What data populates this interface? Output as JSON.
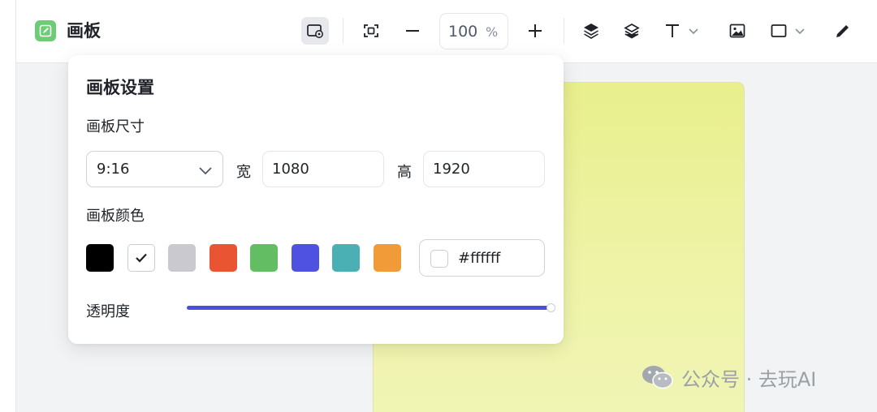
{
  "app": {
    "title": "画板",
    "logo_icon": "edit-board-icon",
    "logo_color": "#6ecb76"
  },
  "toolbar": {
    "items": [
      {
        "name": "board-settings-button",
        "icon": "board-settings-icon",
        "active": true
      },
      {
        "name": "fit-screen-button",
        "icon": "fit-screen-icon"
      },
      {
        "name": "zoom-out-button",
        "icon": "minus-icon"
      },
      {
        "name": "zoom-in-button",
        "icon": "plus-icon"
      },
      {
        "name": "layer-up-button",
        "icon": "layer-up-icon"
      },
      {
        "name": "layer-down-button",
        "icon": "layers-icon"
      },
      {
        "name": "text-tool-button",
        "icon": "text-icon",
        "has_dropdown": true
      },
      {
        "name": "image-tool-button",
        "icon": "image-icon"
      },
      {
        "name": "shape-tool-button",
        "icon": "rectangle-icon",
        "has_dropdown": true
      },
      {
        "name": "pen-tool-button",
        "icon": "pen-icon"
      }
    ],
    "zoom": {
      "value": "100",
      "unit": "%"
    }
  },
  "panel": {
    "title": "画板设置",
    "size": {
      "label": "画板尺寸",
      "ratio_value": "9:16",
      "width_label": "宽",
      "width_value": "1080",
      "height_label": "高",
      "height_value": "1920"
    },
    "color": {
      "label": "画板颜色",
      "swatches": [
        {
          "name": "black",
          "hex": "#000000",
          "selected": false
        },
        {
          "name": "white",
          "hex": "#ffffff",
          "selected": true
        },
        {
          "name": "gray",
          "hex": "#c9c9cf",
          "selected": false
        },
        {
          "name": "red",
          "hex": "#e95432",
          "selected": false
        },
        {
          "name": "green",
          "hex": "#63bd63",
          "selected": false
        },
        {
          "name": "blue",
          "hex": "#4f51e0",
          "selected": false
        },
        {
          "name": "teal",
          "hex": "#4bb0b3",
          "selected": false
        },
        {
          "name": "orange",
          "hex": "#f09a38",
          "selected": false
        }
      ],
      "hex_value": "#ffffff"
    },
    "opacity": {
      "label": "透明度",
      "value_percent": 100,
      "accent": "#4a50d8"
    }
  },
  "canvas": {
    "gradient_top": "#e8ef8c",
    "gradient_bottom": "#f1f5b5"
  },
  "watermark": {
    "text": "公众号 · 去玩AI",
    "icon": "wechat-icon"
  }
}
